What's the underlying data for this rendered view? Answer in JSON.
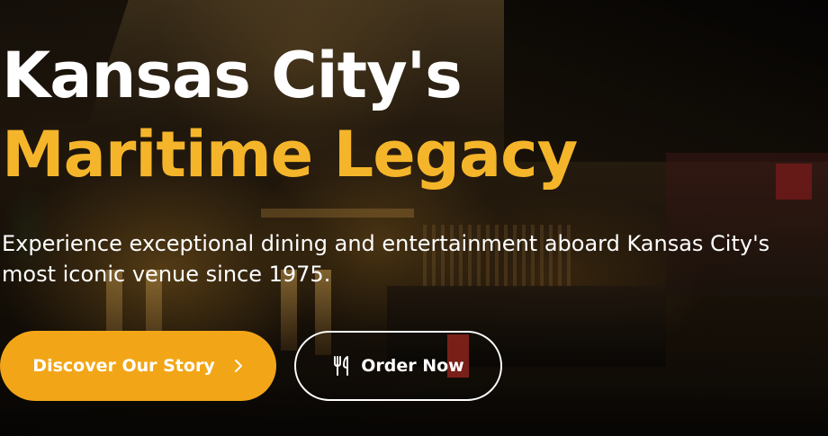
{
  "hero": {
    "headline_line1": "Kansas City's",
    "headline_line2": "Maritime Legacy",
    "subtitle": "Experience exceptional dining and entertainment aboard Kansas City's most iconic venue since 1975.",
    "primary_button_label": "Discover Our Story",
    "primary_button_icon": "chevron-right-icon",
    "secondary_button_label": "Order Now",
    "secondary_button_icon": "utensils-icon"
  },
  "colors": {
    "accent": "#f2a617",
    "headline_accent": "#f5b52a",
    "text": "#ffffff"
  }
}
